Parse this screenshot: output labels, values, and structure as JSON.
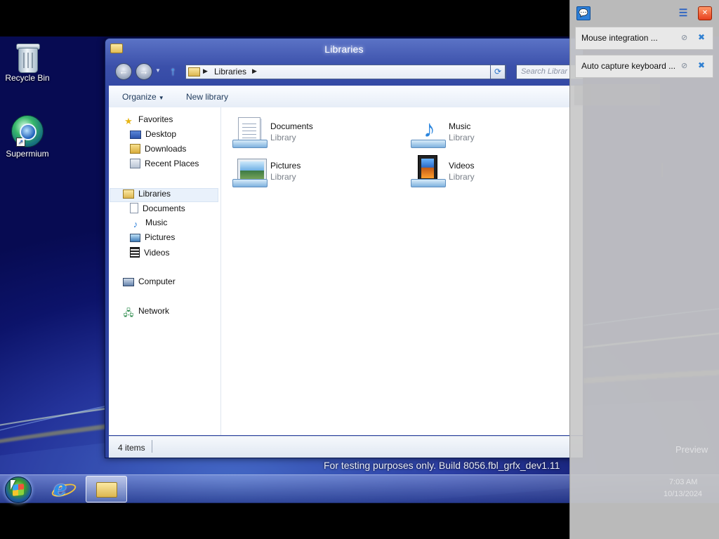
{
  "desktop": {
    "icons": [
      {
        "label": "Recycle Bin"
      },
      {
        "label": "Supermium"
      }
    ],
    "watermark": "For testing purposes only. Build 8056.fbl_grfx_dev1.11"
  },
  "window": {
    "title": "Libraries",
    "address": {
      "crumb": "Libraries",
      "search_placeholder": "Search Librar"
    },
    "toolbar": {
      "organize": "Organize",
      "new_library": "New library"
    },
    "nav": {
      "favorites": {
        "label": "Favorites",
        "items": [
          "Desktop",
          "Downloads",
          "Recent Places"
        ]
      },
      "libraries": {
        "label": "Libraries",
        "items": [
          "Documents",
          "Music",
          "Pictures",
          "Videos"
        ]
      },
      "computer": "Computer",
      "network": "Network"
    },
    "tiles": [
      {
        "name": "Documents",
        "type": "Library",
        "icon": "documents-library-icon"
      },
      {
        "name": "Music",
        "type": "Library",
        "icon": "music-library-icon"
      },
      {
        "name": "Pictures",
        "type": "Library",
        "icon": "pictures-library-icon"
      },
      {
        "name": "Videos",
        "type": "Library",
        "icon": "videos-library-icon"
      }
    ],
    "status": {
      "count": "4 items"
    }
  },
  "panel": {
    "cards": [
      {
        "text": "Mouse integration ..."
      },
      {
        "text": "Auto capture keyboard ..."
      }
    ],
    "ghost_texts": [
      "Preview",
      "7:03 AM",
      "10/13/2024"
    ]
  }
}
